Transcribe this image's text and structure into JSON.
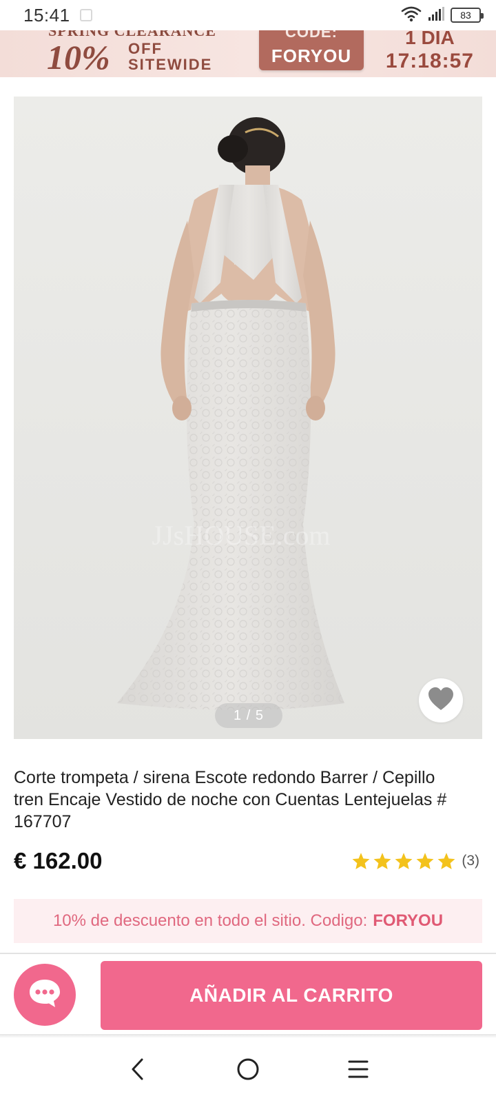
{
  "status_bar": {
    "time": "15:41",
    "battery": "83",
    "icons": [
      "notification-icon",
      "wifi-icon",
      "signal-icon",
      "battery-icon"
    ]
  },
  "promo_banner": {
    "headline": "SPRING CLEARANCE",
    "discount": "10%",
    "off": "OFF",
    "sitewide": "SITEWIDE",
    "code_label": "CODE:",
    "code": "FORYOU",
    "days": "1 DIA",
    "countdown": "17:18:57",
    "colors": {
      "background": "#f3ddd8",
      "text": "#8f4b3f",
      "code_box": "#b26a5e"
    }
  },
  "product_image": {
    "counter": "1 / 5",
    "watermark": "JJsHOUSE.com",
    "favorite_icon": "heart-icon"
  },
  "product": {
    "title": "Corte trompeta / sirena Escote redondo Barrer / Cepillo tren Encaje Vestido de noche con Cuentas Lentejuelas # 167707",
    "price": "€ 162.00",
    "rating_stars": 5,
    "rating_count": "(3)"
  },
  "discount_notice": {
    "text": "10% de descuento en todo el sitio. Codigo:",
    "code": "FORYOU"
  },
  "actions": {
    "chat_icon": "chat-bubble-icon",
    "add_to_cart": "AÑADIR AL CARRITO",
    "accent_color": "#f1688d"
  },
  "nav_bar": {
    "icons": [
      "back-icon",
      "home-icon",
      "menu-icon"
    ]
  }
}
